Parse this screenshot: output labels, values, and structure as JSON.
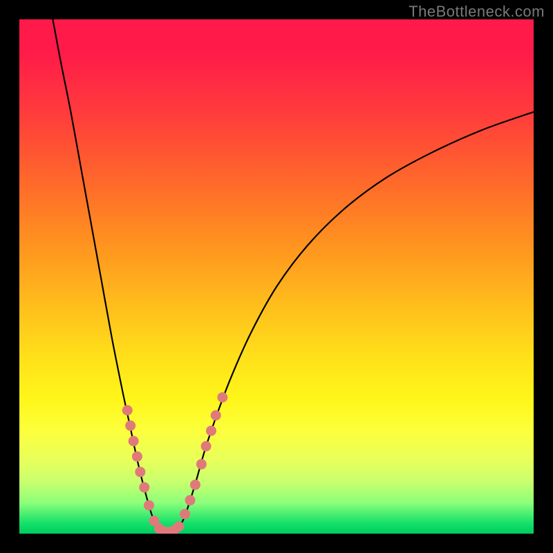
{
  "watermark": "TheBottleneck.com",
  "colors": {
    "background": "#000000",
    "gradient_top": "#ff1a4a",
    "gradient_bottom": "#00cc5e",
    "curve": "#000000",
    "dot_fill": "#e07a7a"
  },
  "chart_data": {
    "type": "line",
    "title": "",
    "xlabel": "",
    "ylabel": "",
    "xlim": [
      0,
      100
    ],
    "ylim": [
      0,
      100
    ],
    "curve_points": [
      {
        "x": 6.5,
        "y": 100
      },
      {
        "x": 8,
        "y": 92
      },
      {
        "x": 10,
        "y": 82
      },
      {
        "x": 12,
        "y": 71
      },
      {
        "x": 14,
        "y": 60
      },
      {
        "x": 16,
        "y": 49
      },
      {
        "x": 18,
        "y": 38
      },
      {
        "x": 20,
        "y": 28
      },
      {
        "x": 21.5,
        "y": 21
      },
      {
        "x": 23,
        "y": 14
      },
      {
        "x": 24.5,
        "y": 8
      },
      {
        "x": 26,
        "y": 3
      },
      {
        "x": 27.5,
        "y": 0.7
      },
      {
        "x": 29,
        "y": 0.2
      },
      {
        "x": 30.5,
        "y": 0.7
      },
      {
        "x": 32,
        "y": 3
      },
      {
        "x": 34,
        "y": 9
      },
      {
        "x": 36,
        "y": 16
      },
      {
        "x": 38,
        "y": 22
      },
      {
        "x": 41,
        "y": 30
      },
      {
        "x": 45,
        "y": 39
      },
      {
        "x": 50,
        "y": 48
      },
      {
        "x": 56,
        "y": 56
      },
      {
        "x": 63,
        "y": 63
      },
      {
        "x": 71,
        "y": 69
      },
      {
        "x": 80,
        "y": 74
      },
      {
        "x": 90,
        "y": 78.5
      },
      {
        "x": 100,
        "y": 82
      }
    ],
    "dots": [
      {
        "x": 21.0,
        "y": 24
      },
      {
        "x": 21.6,
        "y": 21
      },
      {
        "x": 22.2,
        "y": 18
      },
      {
        "x": 22.9,
        "y": 15
      },
      {
        "x": 23.5,
        "y": 12
      },
      {
        "x": 24.3,
        "y": 9
      },
      {
        "x": 25.2,
        "y": 5.5
      },
      {
        "x": 26.2,
        "y": 2.5
      },
      {
        "x": 27.2,
        "y": 1.0
      },
      {
        "x": 28.1,
        "y": 0.4
      },
      {
        "x": 29.0,
        "y": 0.3
      },
      {
        "x": 30.0,
        "y": 0.6
      },
      {
        "x": 31.0,
        "y": 1.4
      },
      {
        "x": 32.2,
        "y": 3.8
      },
      {
        "x": 33.2,
        "y": 6.5
      },
      {
        "x": 34.2,
        "y": 9.5
      },
      {
        "x": 35.4,
        "y": 13.5
      },
      {
        "x": 36.3,
        "y": 17.0
      },
      {
        "x": 37.3,
        "y": 20.0
      },
      {
        "x": 38.2,
        "y": 23.0
      },
      {
        "x": 39.5,
        "y": 26.5
      }
    ]
  }
}
